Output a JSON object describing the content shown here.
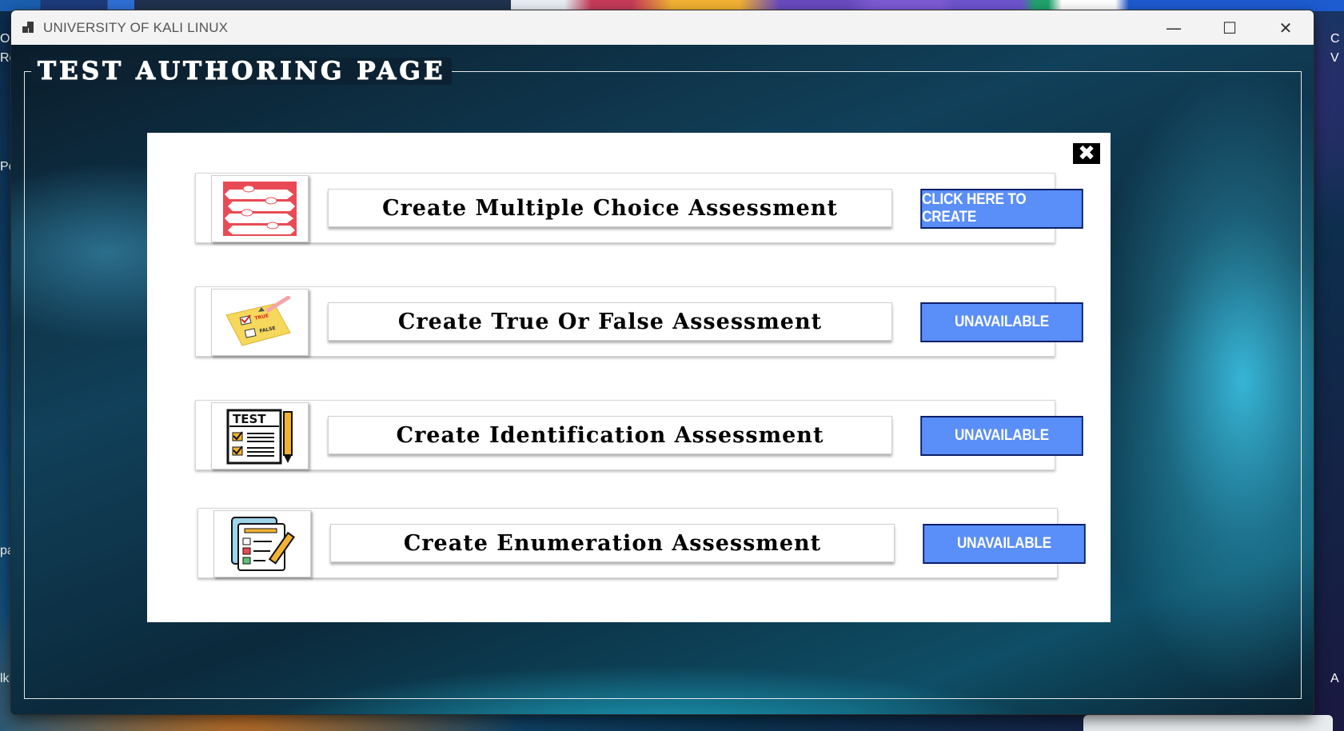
{
  "window": {
    "title": "UNIVERSITY OF KALI LINUX",
    "minimize_glyph": "—",
    "maximize_glyph": "☐",
    "close_glyph": "✕"
  },
  "page": {
    "heading": "TEST AUTHORING PAGE",
    "close_glyph": "✖"
  },
  "assessments": [
    {
      "label": "Create Multiple Choice Assessment",
      "button": "CLICK HERE TO CREATE",
      "icon": "multiple-choice-icon"
    },
    {
      "label": "Create True Or False Assessment",
      "button": "UNAVAILABLE",
      "icon": "true-false-note-icon"
    },
    {
      "label": "Create Identification Assessment",
      "button": "UNAVAILABLE",
      "icon": "test-paper-pencil-icon"
    },
    {
      "label": "Create Enumeration Assessment",
      "button": "UNAVAILABLE",
      "icon": "checklist-clipboard-icon"
    }
  ],
  "desktop": {
    "left_fragments": [
      "Or",
      "Re",
      "Pe",
      "pa",
      "lk"
    ],
    "right_fragments": [
      "C",
      "V",
      "A"
    ]
  },
  "colors": {
    "button_blue": "#5a8ef8",
    "button_border": "#0a1f6b",
    "panel_bg": "#ffffff"
  }
}
